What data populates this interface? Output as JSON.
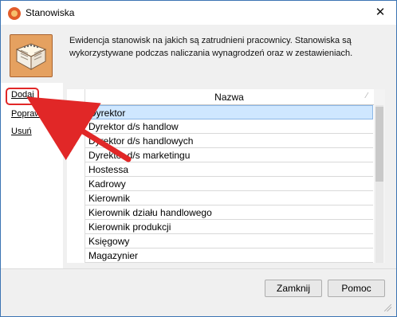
{
  "window": {
    "title": "Stanowiska",
    "close_label": "✕"
  },
  "intro": {
    "text": "Ewidencja stanowisk na jakich są zatrudnieni pracownicy. Stanowiska są wykorzystywane podczas naliczania wynagrodzeń oraz w zestawieniach."
  },
  "sidebar": {
    "add": "Dodaj",
    "edit": "Popraw",
    "delete": "Usuń"
  },
  "grid": {
    "column_name": "Nazwa",
    "rows": [
      "Dyrektor",
      "Dyrektor d/s handlow",
      "Dyrektor d/s handlowych",
      "Dyrektor d/s marketingu",
      "Hostessa",
      "Kadrowy",
      "Kierownik",
      "Kierownik działu handlowego",
      "Kierownik produkcji",
      "Księgowy",
      "Magazynier"
    ]
  },
  "buttons": {
    "close": "Zamknij",
    "help": "Pomoc"
  },
  "colors": {
    "accent_red": "#e12727",
    "selection": "#cfe7ff"
  },
  "icons": {
    "app": "app-icon",
    "hero": "folder-book-icon",
    "close": "close-icon",
    "row_pointer": "row-pointer-icon",
    "sort": "sort-icon",
    "resize": "resize-grip-icon"
  }
}
